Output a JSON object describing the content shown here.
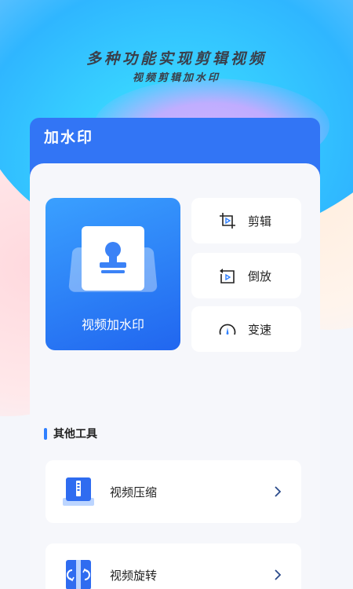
{
  "header": {
    "headline": "多种功能实现剪辑视频",
    "subheadline": "视频剪辑加水印"
  },
  "panel": {
    "title": "加水印"
  },
  "features": {
    "main": {
      "label": "视频加水印",
      "icon": "stamp-icon"
    },
    "items": [
      {
        "label": "剪辑",
        "icon": "crop-play-icon"
      },
      {
        "label": "倒放",
        "icon": "rewind-play-icon"
      },
      {
        "label": "变速",
        "icon": "speedometer-icon"
      }
    ]
  },
  "other_tools": {
    "title": "其他工具",
    "items": [
      {
        "label": "视频压缩",
        "icon": "compress-icon"
      },
      {
        "label": "视频旋转",
        "icon": "rotate-icon"
      }
    ]
  },
  "colors": {
    "primary": "#3275f5",
    "accent": "#2f80ff",
    "background": "#f6f7fb",
    "text": "#222222"
  }
}
